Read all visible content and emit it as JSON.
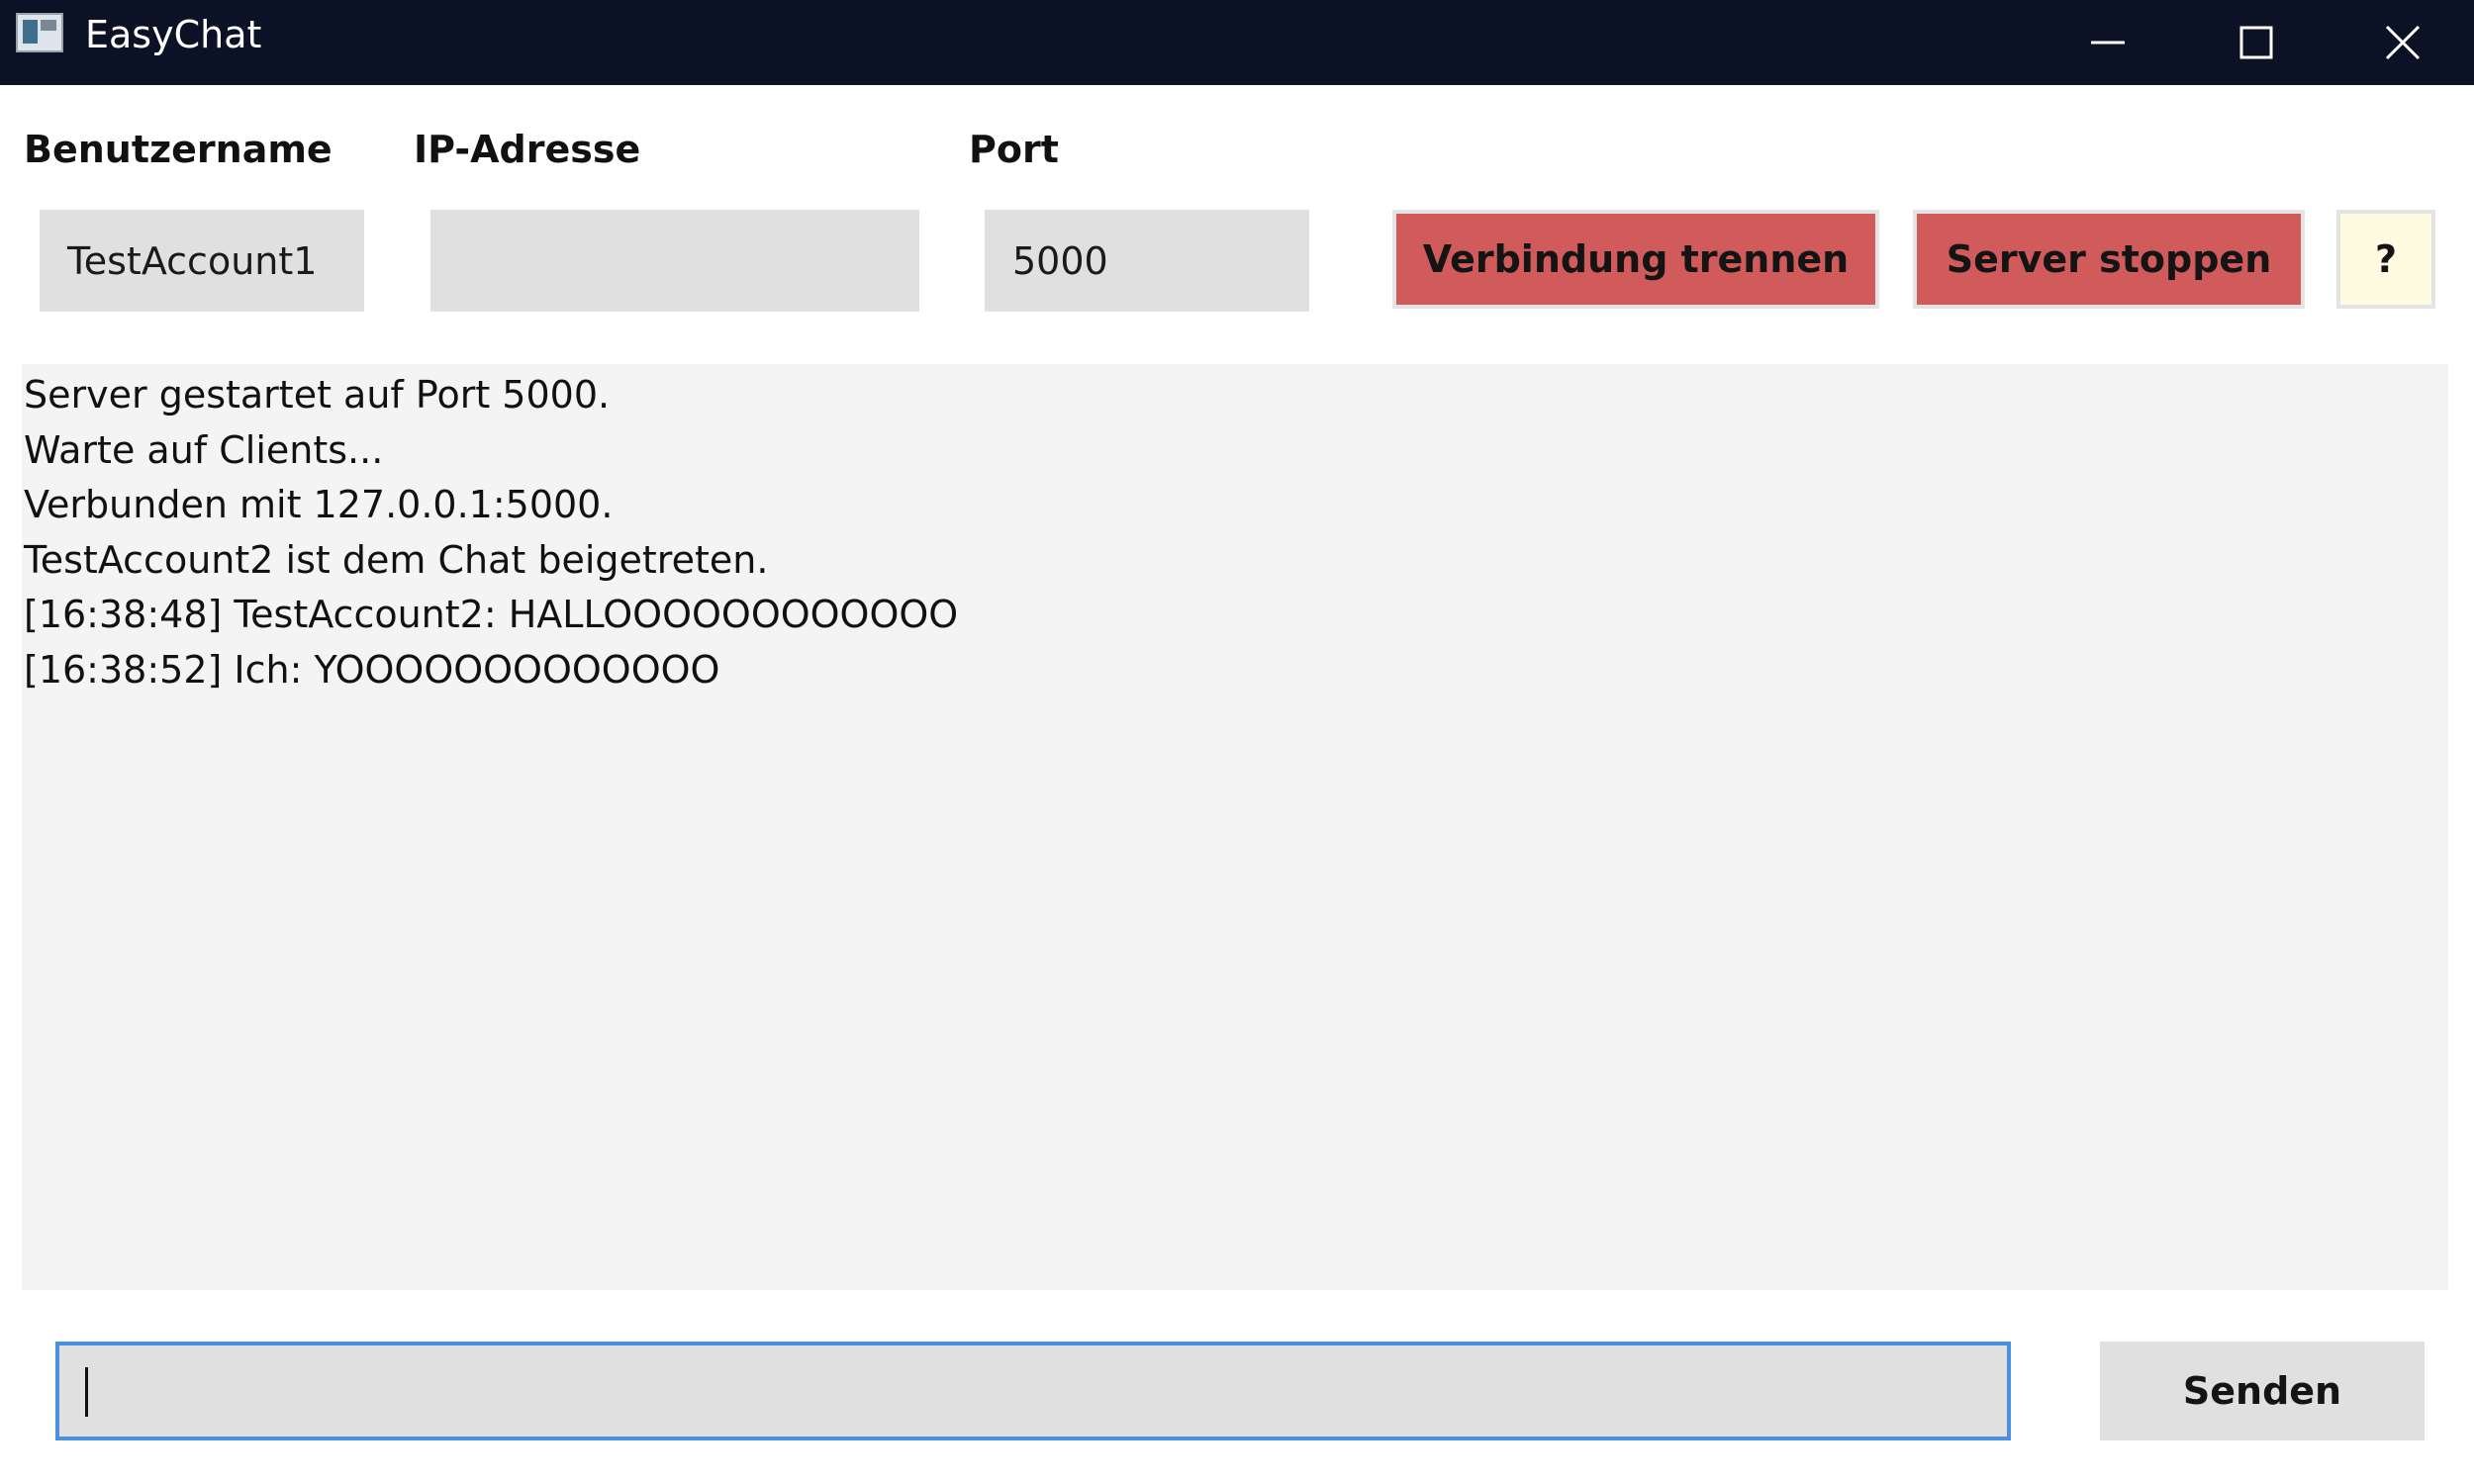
{
  "window": {
    "title": "EasyChat"
  },
  "labels": {
    "username": "Benutzername",
    "ip_address": "IP-Adresse",
    "port": "Port"
  },
  "fields": {
    "username_value": "TestAccount1",
    "ip_value": "",
    "port_value": "5000"
  },
  "buttons": {
    "disconnect": "Verbindung trennen",
    "stop_server": "Server stoppen",
    "help": "?",
    "send": "Senden"
  },
  "chat": {
    "lines": [
      "Server gestartet auf Port 5000.",
      "Warte auf Clients...",
      "Verbunden mit 127.0.0.1:5000.",
      "TestAccount2 ist dem Chat beigetreten.",
      "[16:38:48] TestAccount2: HALLOOOOOOOOOOOO",
      "[16:38:52] Ich: YOOOOOOOOOOOOO"
    ]
  },
  "message_input": {
    "value": ""
  },
  "colors": {
    "titlebar": "#0b1226",
    "danger_button": "#d15b5b",
    "help_button": "#fffbe0",
    "input_bg": "#e0e0e0",
    "focus_border": "#4a8fe0",
    "log_bg": "#f4f4f4"
  },
  "icons": {
    "app": "app-window-icon",
    "minimize": "minimize-icon",
    "maximize": "maximize-icon",
    "close": "close-icon"
  }
}
